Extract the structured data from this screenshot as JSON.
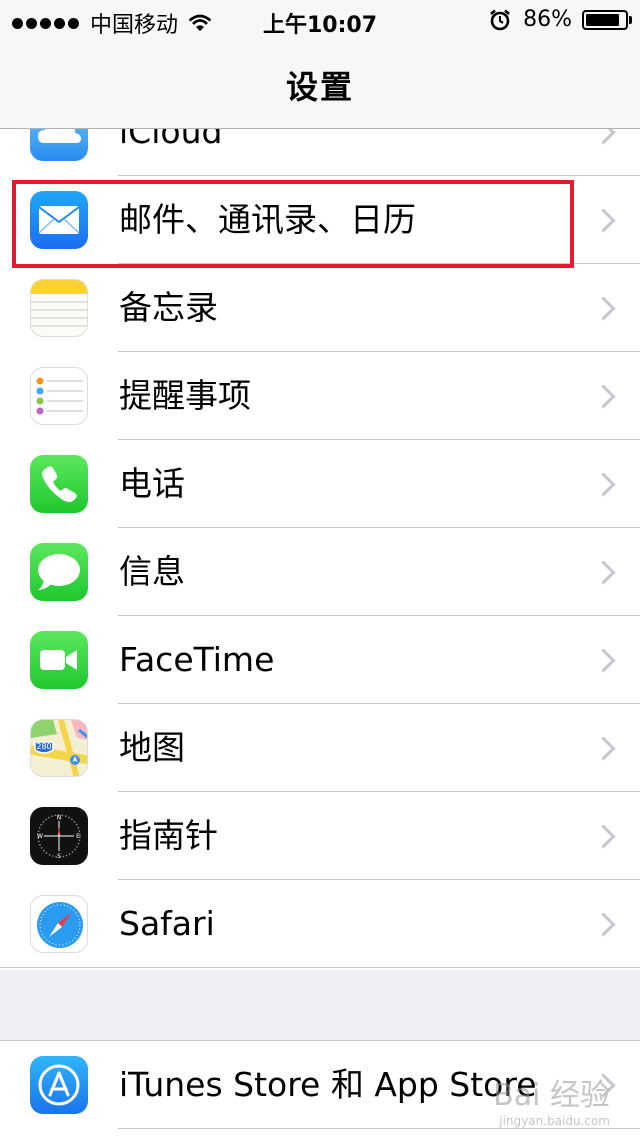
{
  "status_bar": {
    "carrier": "中国移动",
    "time": "上午10:07",
    "battery_percent": "86%",
    "battery_level": 0.86,
    "icons": [
      "signal-dots-icon",
      "wifi-icon",
      "alarm-clock-icon",
      "battery-icon"
    ]
  },
  "nav": {
    "title": "设置"
  },
  "settings": {
    "group1": [
      {
        "label": "iCloud",
        "icon": "icloud-icon"
      },
      {
        "label": "邮件、通讯录、日历",
        "icon": "mail-icon"
      },
      {
        "label": "备忘录",
        "icon": "notes-icon"
      },
      {
        "label": "提醒事项",
        "icon": "reminders-icon"
      },
      {
        "label": "电话",
        "icon": "phone-icon"
      },
      {
        "label": "信息",
        "icon": "messages-icon"
      },
      {
        "label": "FaceTime",
        "icon": "facetime-icon"
      },
      {
        "label": "地图",
        "icon": "maps-icon"
      },
      {
        "label": "指南针",
        "icon": "compass-icon"
      },
      {
        "label": "Safari",
        "icon": "safari-icon"
      }
    ],
    "group2": [
      {
        "label": "iTunes Store 和 App Store",
        "icon": "app-store-icon"
      }
    ]
  },
  "map_icon": {
    "shield_number": "280"
  },
  "compass_icon": {
    "letters": [
      "N",
      "E",
      "S",
      "W"
    ]
  },
  "watermark": {
    "text": "Bai 经验",
    "sub": "jingyan.baidu.com"
  },
  "colors": {
    "highlight": "#e31b2b",
    "separator": "#c8c7cc",
    "background": "#efeff4"
  }
}
